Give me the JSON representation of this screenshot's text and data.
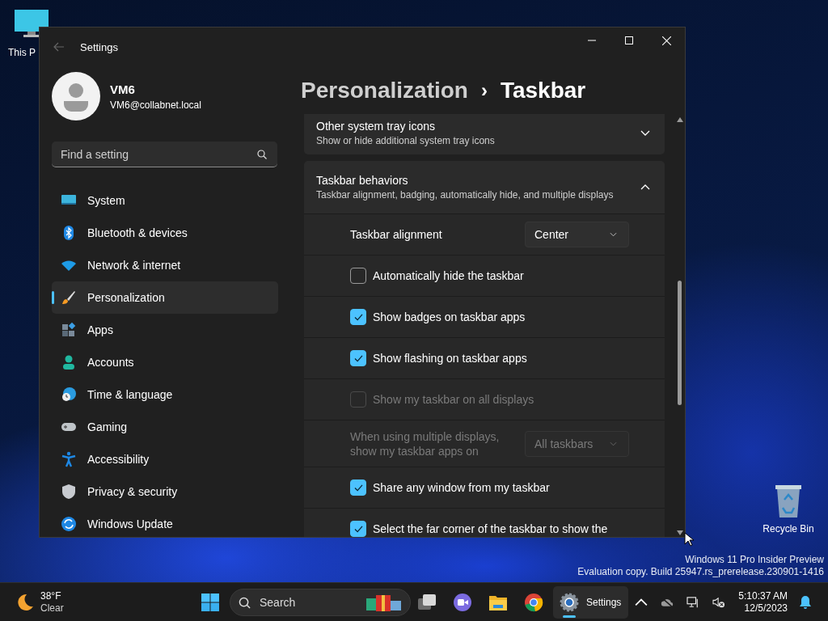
{
  "desktop": {
    "icons": [
      {
        "label": "This P"
      },
      {
        "label": "Recycle Bin"
      }
    ],
    "watermark": [
      "Windows 11 Pro Insider Preview",
      "Evaluation copy. Build 25947.rs_prerelease.230901-1416"
    ]
  },
  "window": {
    "title": "Settings",
    "user": {
      "name": "VM6",
      "email": "VM6@collabnet.local"
    },
    "search": {
      "placeholder": "Find a setting"
    },
    "nav": [
      {
        "label": "System",
        "selected": false
      },
      {
        "label": "Bluetooth & devices",
        "selected": false
      },
      {
        "label": "Network & internet",
        "selected": false
      },
      {
        "label": "Personalization",
        "selected": true
      },
      {
        "label": "Apps",
        "selected": false
      },
      {
        "label": "Accounts",
        "selected": false
      },
      {
        "label": "Time & language",
        "selected": false
      },
      {
        "label": "Gaming",
        "selected": false
      },
      {
        "label": "Accessibility",
        "selected": false
      },
      {
        "label": "Privacy & security",
        "selected": false
      },
      {
        "label": "Windows Update",
        "selected": false
      }
    ],
    "breadcrumb": {
      "parent": "Personalization",
      "separator": "›",
      "current": "Taskbar"
    },
    "sections": [
      {
        "title": "Other system tray icons",
        "subtitle": "Show or hide additional system tray icons",
        "expanded": false
      },
      {
        "title": "Taskbar behaviors",
        "subtitle": "Taskbar alignment, badging, automatically hide, and multiple displays",
        "expanded": true,
        "rows": [
          {
            "kind": "dropdown",
            "label": "Taskbar alignment",
            "value": "Center",
            "disabled": false
          },
          {
            "kind": "checkbox",
            "label": "Automatically hide the taskbar",
            "checked": false,
            "disabled": false
          },
          {
            "kind": "checkbox",
            "label": "Show badges on taskbar apps",
            "checked": true,
            "disabled": false
          },
          {
            "kind": "checkbox",
            "label": "Show flashing on taskbar apps",
            "checked": true,
            "disabled": false
          },
          {
            "kind": "checkbox",
            "label": "Show my taskbar on all displays",
            "checked": false,
            "disabled": true
          },
          {
            "kind": "dropdown",
            "label": "When using multiple displays, show my taskbar apps on",
            "value": "All taskbars",
            "disabled": true
          },
          {
            "kind": "checkbox",
            "label": "Share any window from my taskbar",
            "checked": true,
            "disabled": false
          },
          {
            "kind": "checkbox",
            "label": "Select the far corner of the taskbar to show the",
            "checked": true,
            "disabled": false
          }
        ]
      }
    ]
  },
  "taskbar": {
    "weather": {
      "temperature": "38°F",
      "condition": "Clear"
    },
    "search": {
      "placeholder": "Search"
    },
    "apps": [
      {
        "kind": "taskview",
        "selected": false
      },
      {
        "kind": "meet",
        "selected": false
      },
      {
        "kind": "explorer",
        "selected": false
      },
      {
        "kind": "chrome",
        "selected": false
      },
      {
        "kind": "settings",
        "label": "Settings",
        "selected": true
      }
    ],
    "clock": {
      "time": "5:10:37 AM",
      "date": "12/5/2023"
    }
  }
}
